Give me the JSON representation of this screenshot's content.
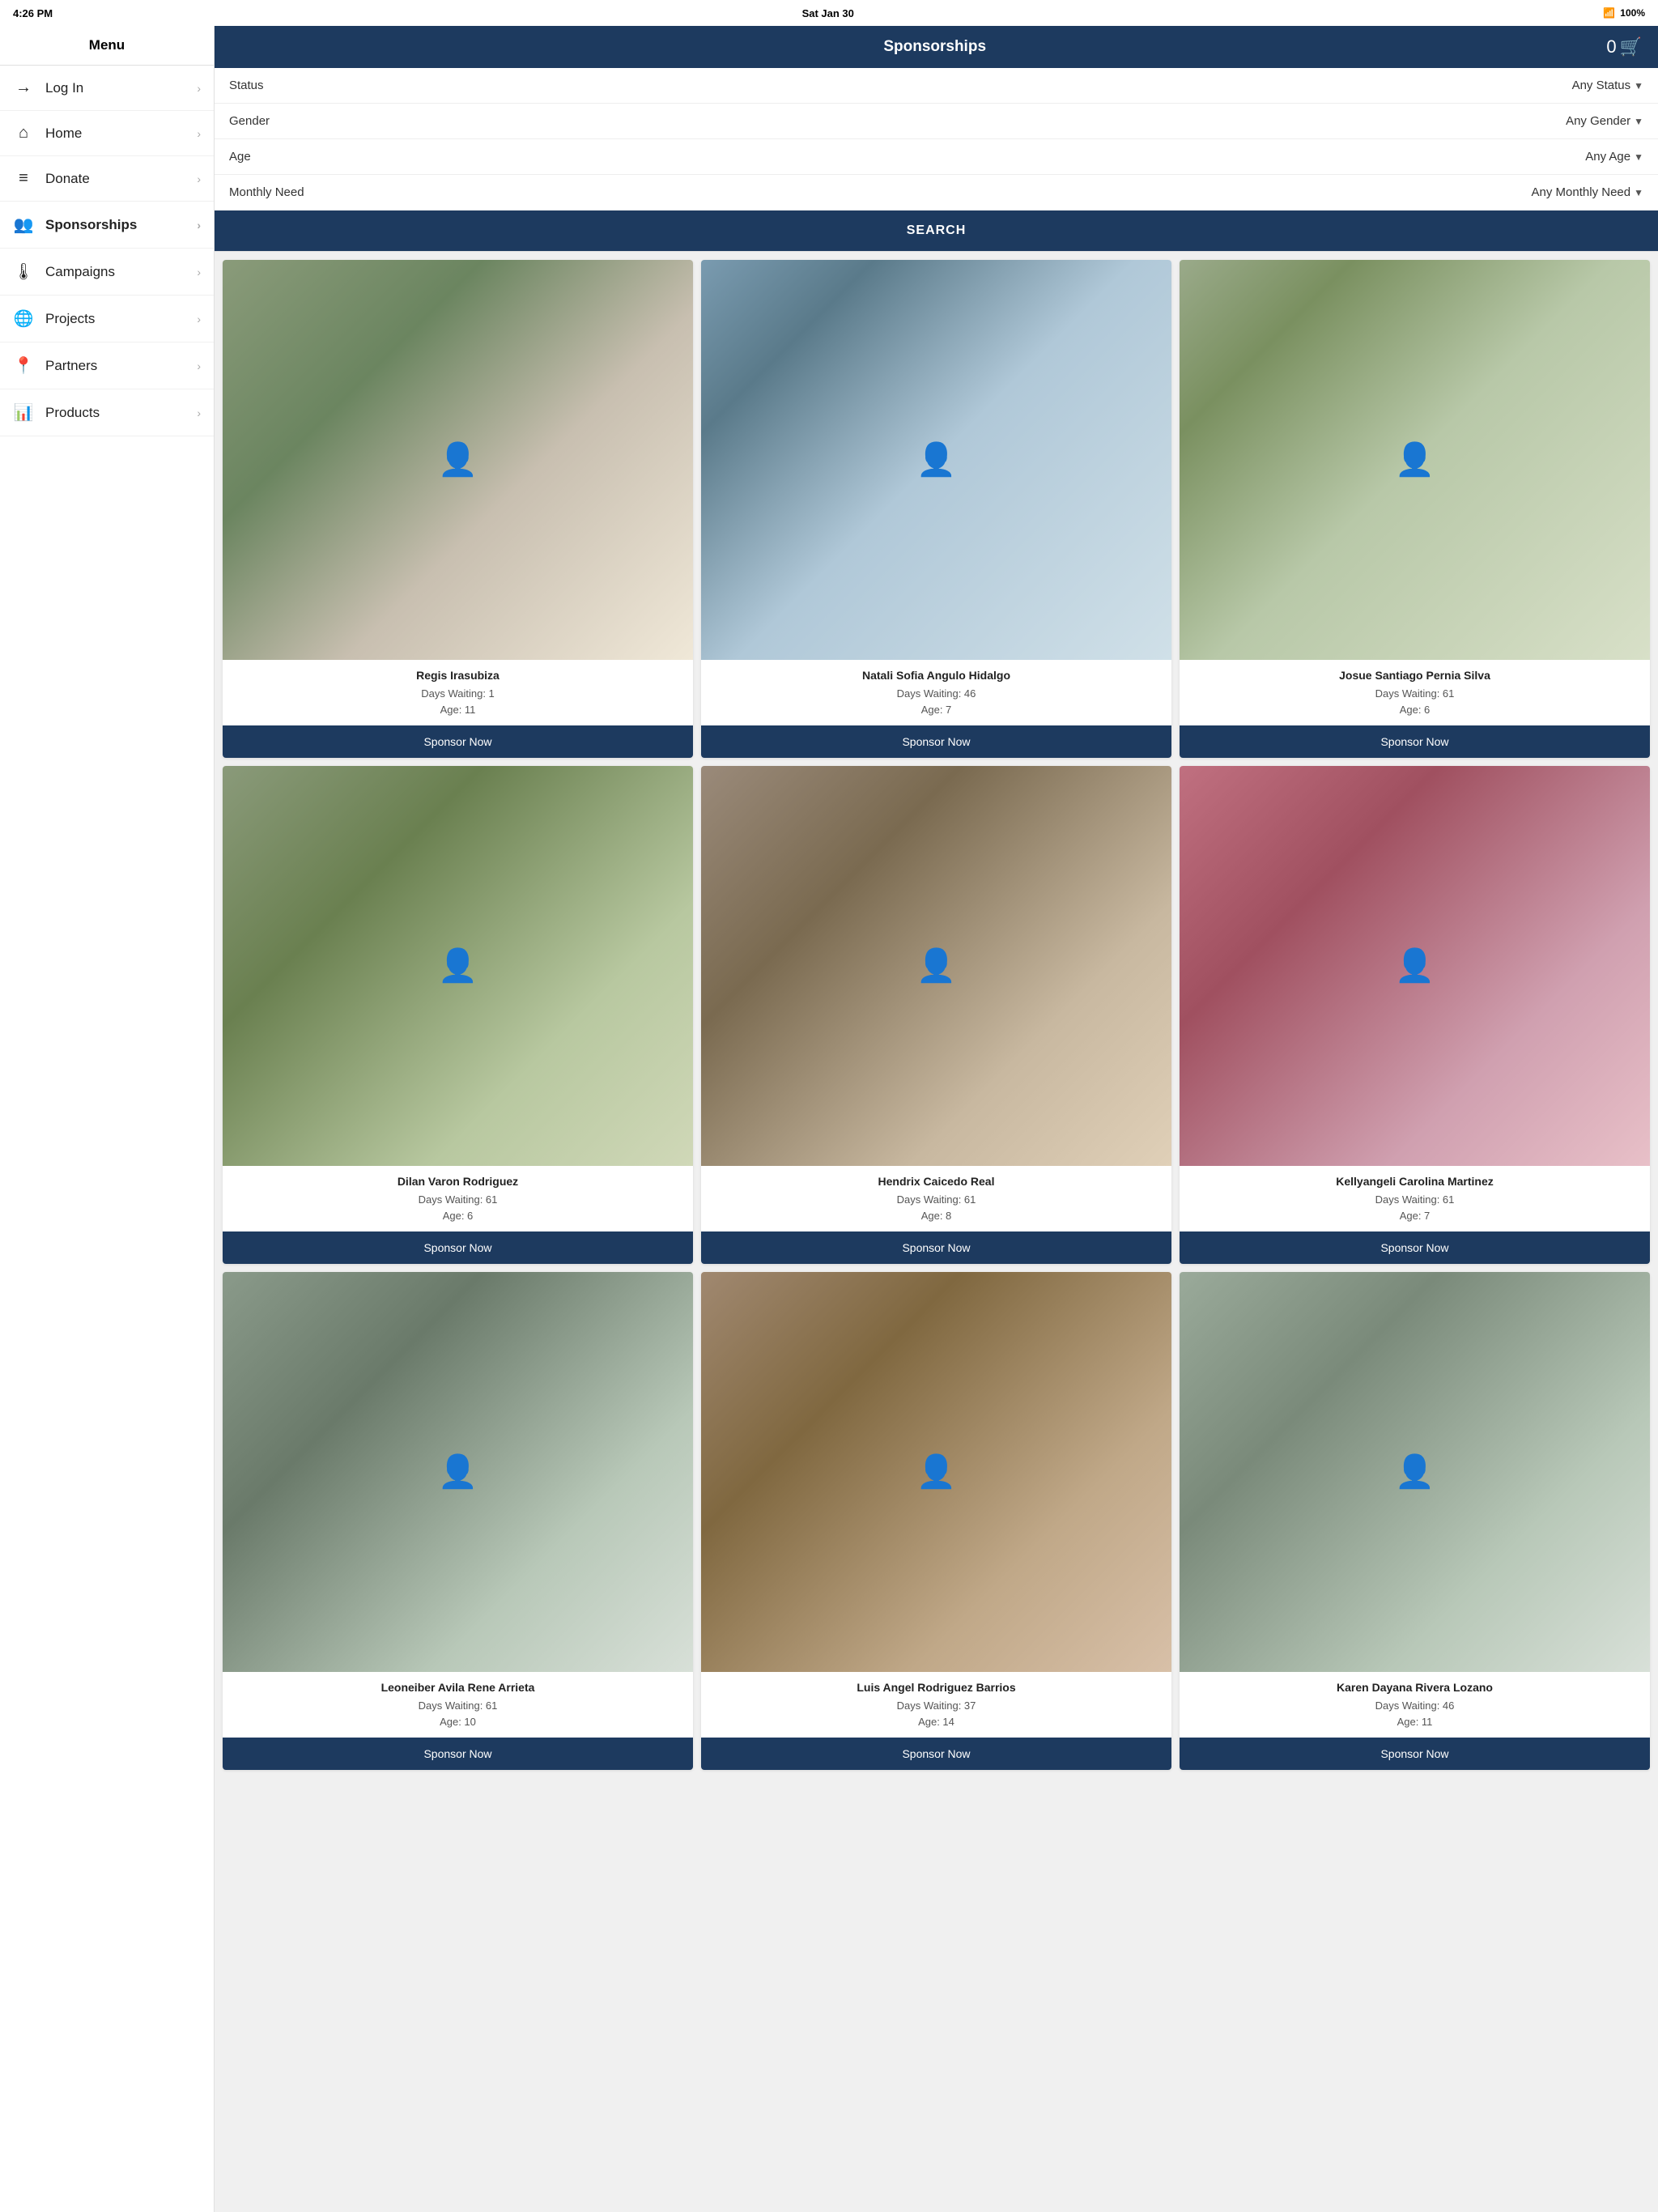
{
  "statusBar": {
    "time": "4:26 PM",
    "date": "Sat Jan 30",
    "signal": "●●●●",
    "wifi": "wifi",
    "battery": "100%"
  },
  "sidebar": {
    "header": "Menu",
    "items": [
      {
        "id": "login",
        "icon": "→",
        "label": "Log In",
        "hasChevron": true
      },
      {
        "id": "home",
        "icon": "⌂",
        "label": "Home",
        "hasChevron": true
      },
      {
        "id": "donate",
        "icon": "≡",
        "label": "Donate",
        "hasChevron": true
      },
      {
        "id": "sponsorships",
        "icon": "👥",
        "label": "Sponsorships",
        "hasChevron": true,
        "active": true
      },
      {
        "id": "campaigns",
        "icon": "🌡",
        "label": "Campaigns",
        "hasChevron": true
      },
      {
        "id": "projects",
        "icon": "🌐",
        "label": "Projects",
        "hasChevron": true
      },
      {
        "id": "partners",
        "icon": "📍",
        "label": "Partners",
        "hasChevron": true
      },
      {
        "id": "products",
        "icon": "📊",
        "label": "Products",
        "hasChevron": true
      }
    ]
  },
  "header": {
    "title": "Sponsorships",
    "cartCount": "0"
  },
  "filters": [
    {
      "id": "status",
      "label": "Status",
      "value": "Any Status"
    },
    {
      "id": "gender",
      "label": "Gender",
      "value": "Any Gender"
    },
    {
      "id": "age",
      "label": "Age",
      "value": "Any Age"
    },
    {
      "id": "monthlyNeed",
      "label": "Monthly Need",
      "value": "Any Monthly Need"
    }
  ],
  "searchButton": "SEARCH",
  "children": [
    {
      "id": "child-1",
      "name": "Regis Irasubiza",
      "daysWaiting": "Days Waiting: 1",
      "age": "Age: 11",
      "buttonLabel": "Sponsor Now",
      "photoClass": "photo-1"
    },
    {
      "id": "child-2",
      "name": "Natali Sofia Angulo Hidalgo",
      "daysWaiting": "Days Waiting: 46",
      "age": "Age: 7",
      "buttonLabel": "Sponsor Now",
      "photoClass": "photo-2"
    },
    {
      "id": "child-3",
      "name": "Josue Santiago Pernia Silva",
      "daysWaiting": "Days Waiting: 61",
      "age": "Age: 6",
      "buttonLabel": "Sponsor Now",
      "photoClass": "photo-3"
    },
    {
      "id": "child-4",
      "name": "Dilan Varon Rodriguez",
      "daysWaiting": "Days Waiting: 61",
      "age": "Age: 6",
      "buttonLabel": "Sponsor Now",
      "photoClass": "photo-4"
    },
    {
      "id": "child-5",
      "name": "Hendrix Caicedo Real",
      "daysWaiting": "Days Waiting: 61",
      "age": "Age: 8",
      "buttonLabel": "Sponsor Now",
      "photoClass": "photo-5"
    },
    {
      "id": "child-6",
      "name": "Kellyangeli Carolina Martinez",
      "daysWaiting": "Days Waiting: 61",
      "age": "Age: 7",
      "buttonLabel": "Sponsor Now",
      "photoClass": "photo-6"
    },
    {
      "id": "child-7",
      "name": "Leoneiber Avila Rene Arrieta",
      "daysWaiting": "Days Waiting: 61",
      "age": "Age: 10",
      "buttonLabel": "Sponsor Now",
      "photoClass": "photo-7"
    },
    {
      "id": "child-8",
      "name": "Luis Angel Rodriguez Barrios",
      "daysWaiting": "Days Waiting: 37",
      "age": "Age: 14",
      "buttonLabel": "Sponsor Now",
      "photoClass": "photo-8"
    },
    {
      "id": "child-9",
      "name": "Karen Dayana Rivera Lozano",
      "daysWaiting": "Days Waiting: 46",
      "age": "Age: 11",
      "buttonLabel": "Sponsor Now",
      "photoClass": "photo-9"
    }
  ]
}
